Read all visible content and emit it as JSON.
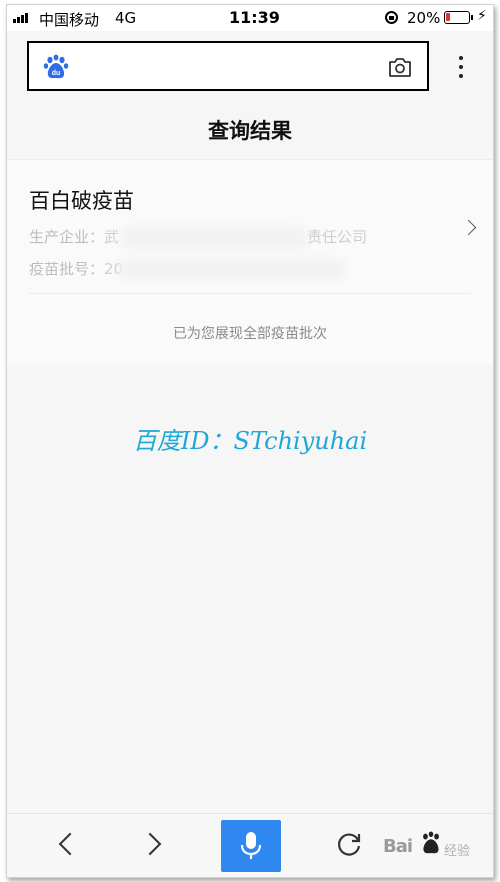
{
  "status_bar": {
    "carrier": "中国移动",
    "network": "4G",
    "time": "11:39",
    "battery_percent_text": "20%",
    "battery_level": 0.2,
    "battery_color": "#e53030"
  },
  "browser": {
    "logo_icon": "baidu-paw-icon",
    "camera_icon": "camera-icon",
    "menu_icon": "more-vertical-icon"
  },
  "page": {
    "title": "查询结果",
    "result": {
      "name": "百白破疫苗",
      "maker_label": "生产企业：",
      "maker_prefix": "武",
      "maker_suffix": "责任公司",
      "batch_label": "疫苗批号：",
      "batch_prefix": "20"
    },
    "all_shown_text": "已为您展现全部疫苗批次"
  },
  "watermark": "百度ID：STchiyuhai",
  "toolbar": {
    "back_icon": "chevron-left-icon",
    "forward_icon": "chevron-right-icon",
    "voice_icon": "microphone-icon",
    "refresh_icon": "refresh-icon",
    "accent_color": "#2f88f0",
    "footer_logo_text": "Bai",
    "footer_logo_suffix": "经验"
  }
}
